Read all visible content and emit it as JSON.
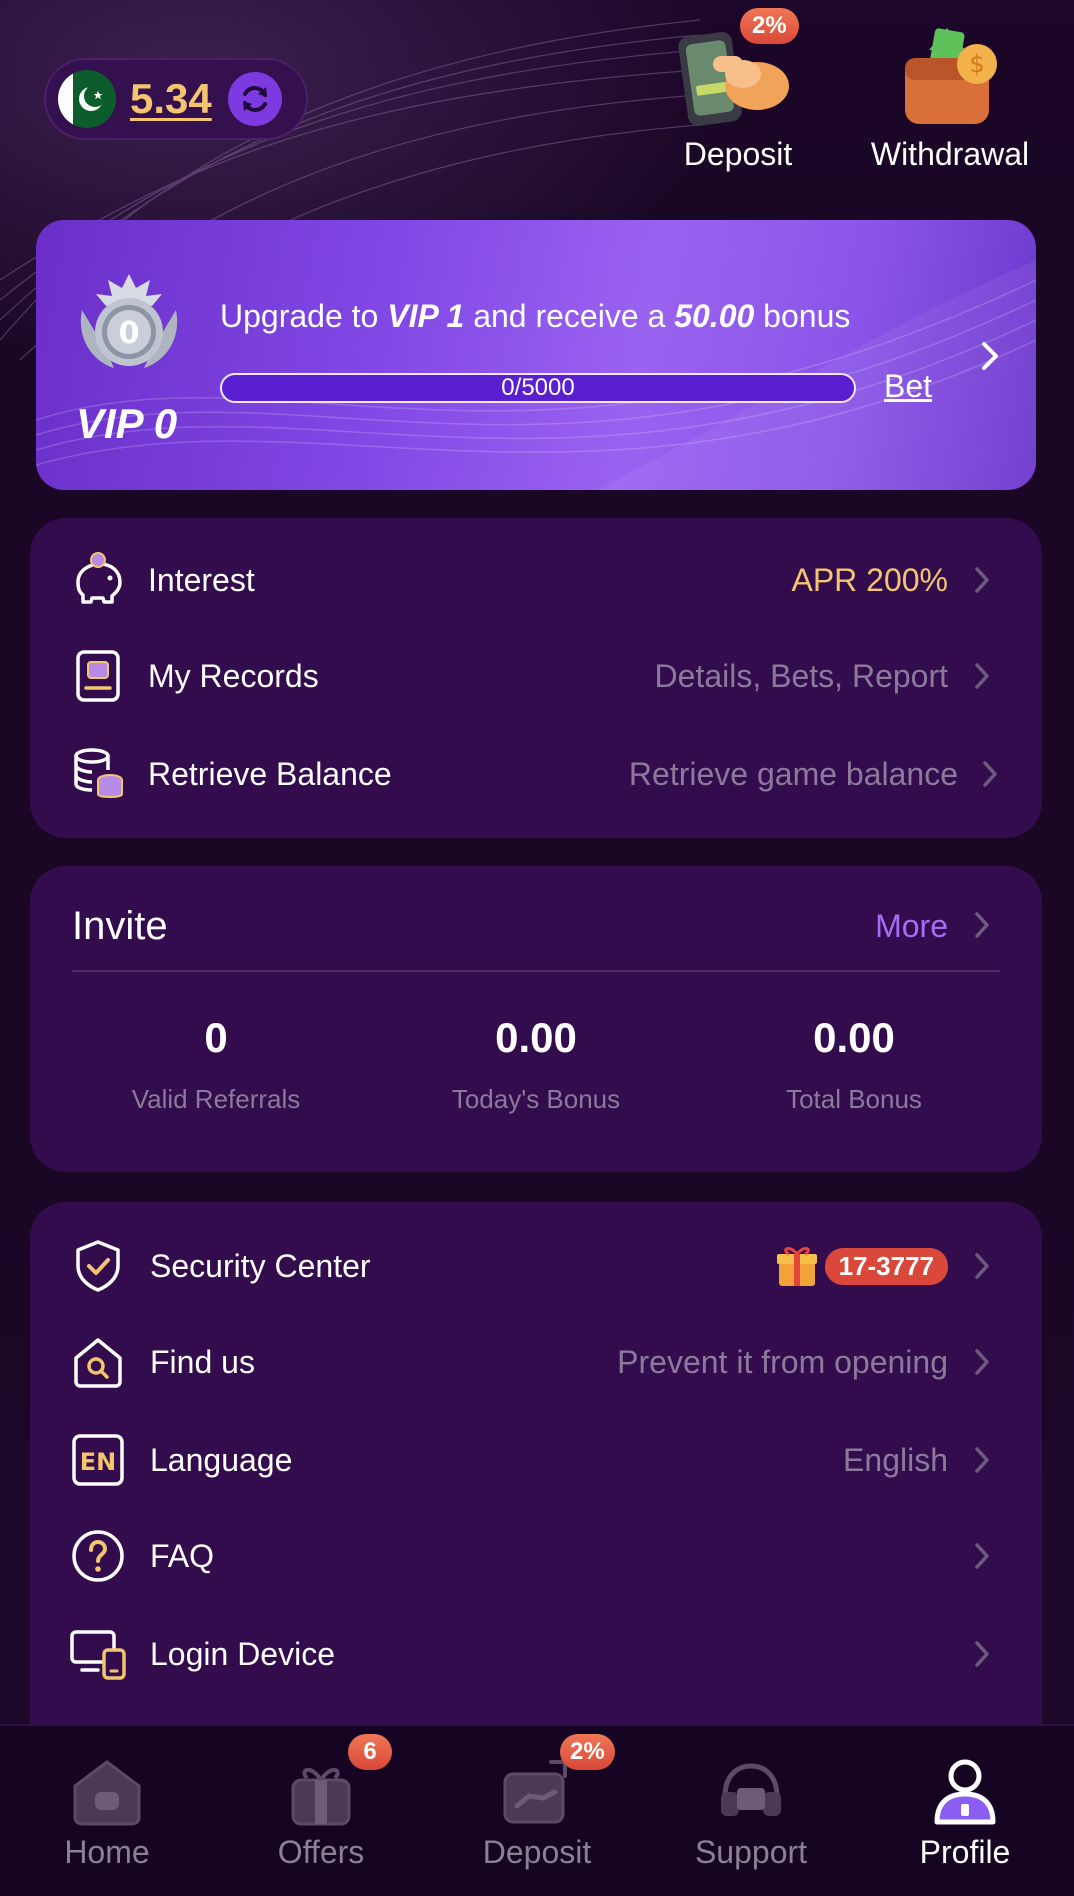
{
  "header": {
    "balance": "5.34",
    "deposit_label": "Deposit",
    "deposit_badge": "2%",
    "withdrawal_label": "Withdrawal"
  },
  "vip": {
    "medal_number": "0",
    "level": "VIP 0",
    "upgrade_prefix": "Upgrade to",
    "upgrade_vip": "VIP 1",
    "upgrade_middle": "and receive a",
    "upgrade_amount": "50.00",
    "upgrade_suffix": "bonus",
    "progress_text": "0/5000",
    "progress_fraction": 0,
    "bet_label": "Bet"
  },
  "menu1": [
    {
      "label": "Interest",
      "value": "APR 200%",
      "icon": "piggy-bank-icon"
    },
    {
      "label": "My Records",
      "value": "Details, Bets, Report",
      "icon": "records-icon"
    },
    {
      "label": "Retrieve Balance",
      "value": "Retrieve game balance",
      "icon": "coin-stack-icon"
    }
  ],
  "invite": {
    "title": "Invite",
    "more_label": "More",
    "stats": [
      {
        "value": "0",
        "caption": "Valid Referrals"
      },
      {
        "value": "0.00",
        "caption": "Today's Bonus"
      },
      {
        "value": "0.00",
        "caption": "Total Bonus"
      }
    ]
  },
  "menu2": [
    {
      "label": "Security Center",
      "value": "17-3777",
      "icon": "shield-check-icon"
    },
    {
      "label": "Find us",
      "value": "Prevent it from opening",
      "icon": "home-search-icon"
    },
    {
      "label": "Language",
      "value": "English",
      "icon": "language-en-icon",
      "icon_text": "EN"
    },
    {
      "label": "FAQ",
      "value": "",
      "icon": "question-icon"
    },
    {
      "label": "Login Device",
      "value": "",
      "icon": "devices-icon"
    }
  ],
  "nav": [
    {
      "label": "Home",
      "icon": "home-icon"
    },
    {
      "label": "Offers",
      "icon": "gift-icon",
      "badge": "6"
    },
    {
      "label": "Deposit",
      "icon": "deposit-icon",
      "badge": "2%"
    },
    {
      "label": "Support",
      "icon": "support-icon"
    },
    {
      "label": "Profile",
      "icon": "profile-icon",
      "active": true
    }
  ],
  "colors": {
    "background": "#1a0726",
    "card": "#330c4d",
    "gold": "#f2c56e",
    "accent_purple": "#a86cf4",
    "muted_text": "#8c7a9c",
    "badge_red": "#d9483a"
  }
}
